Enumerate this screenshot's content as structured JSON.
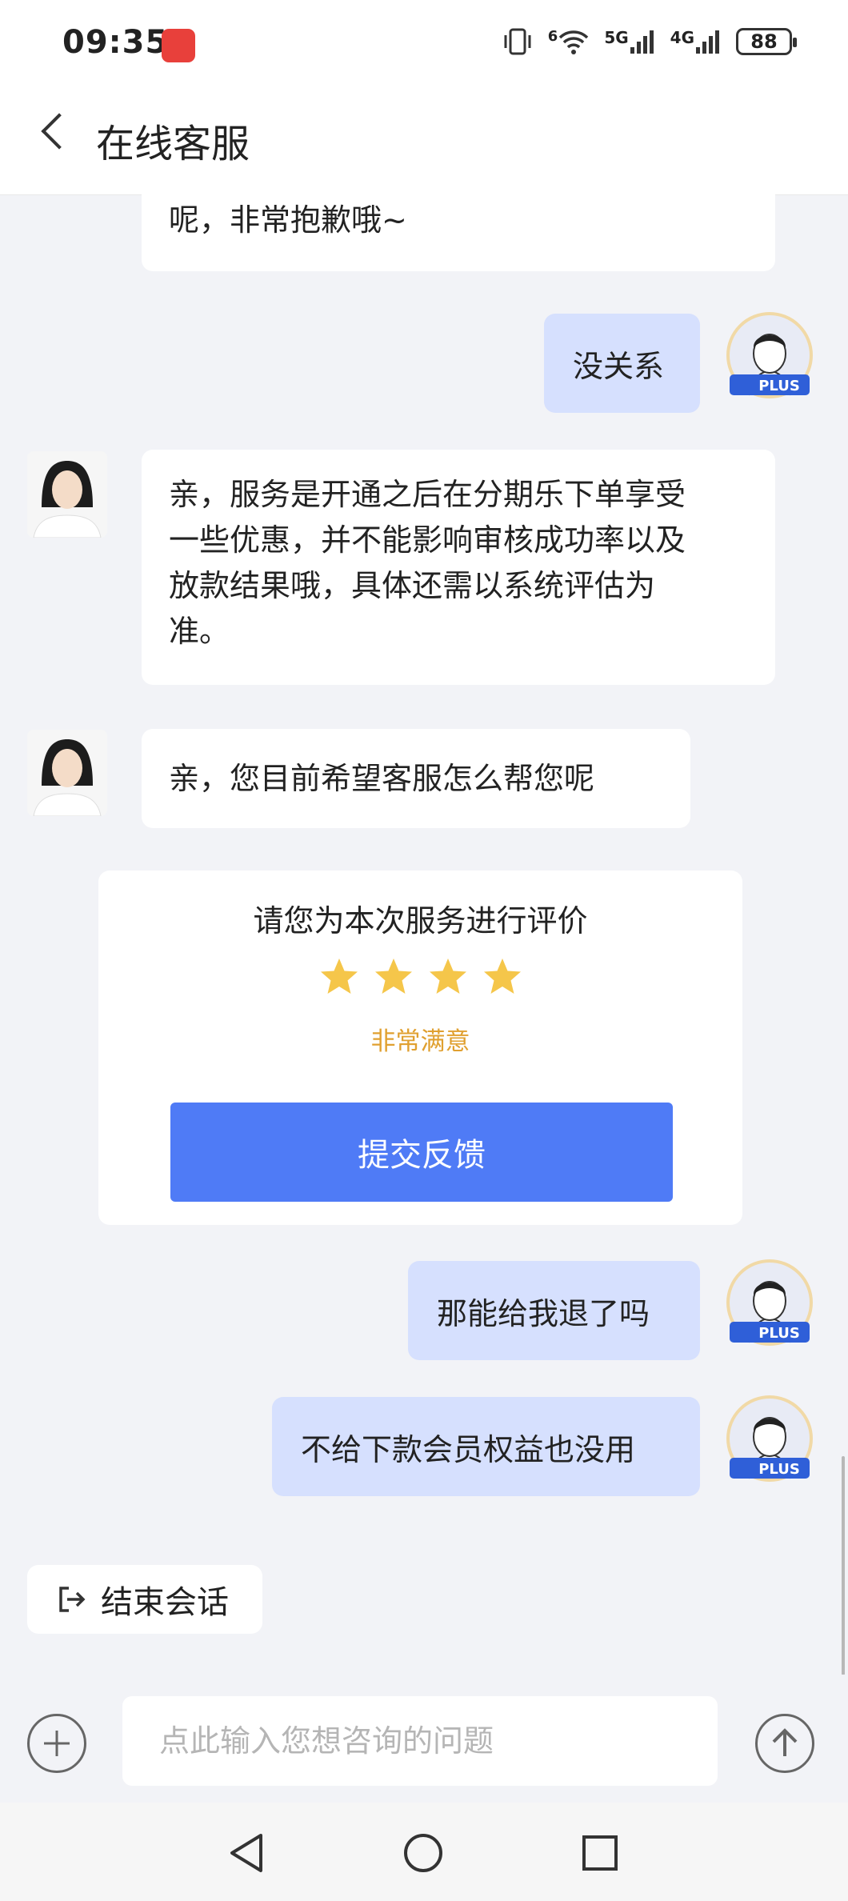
{
  "status_bar": {
    "time": "09:35",
    "network_1": "5G",
    "network_2": "4G",
    "battery": "88",
    "wifi_label": "6"
  },
  "header": {
    "title": "在线客服"
  },
  "messages": {
    "m0": "呢，非常抱歉哦~",
    "m1": "没关系",
    "m2_lines": [
      "亲，服务是开通之后在分期乐下单享受",
      "一些优惠，并不能影响审核成功率以及",
      "放款结果哦，具体还需以系统评估为",
      "准。"
    ],
    "m3": "亲，您目前希望客服怎么帮您呢",
    "m4": "那能给我退了吗",
    "m5": "不给下款会员权益也没用"
  },
  "user_badge": "PLUS",
  "rating": {
    "title": "请您为本次服务进行评价",
    "stars": 4,
    "result_label": "非常满意",
    "submit_label": "提交反馈",
    "star_color": "#f5c64a"
  },
  "end_session": {
    "label": "结束会话"
  },
  "input": {
    "placeholder": "点此输入您想咨询的问题"
  },
  "colors": {
    "accent": "#4f7bf6",
    "user_bubble": "#d6e0fe",
    "background": "#f2f3f7"
  }
}
